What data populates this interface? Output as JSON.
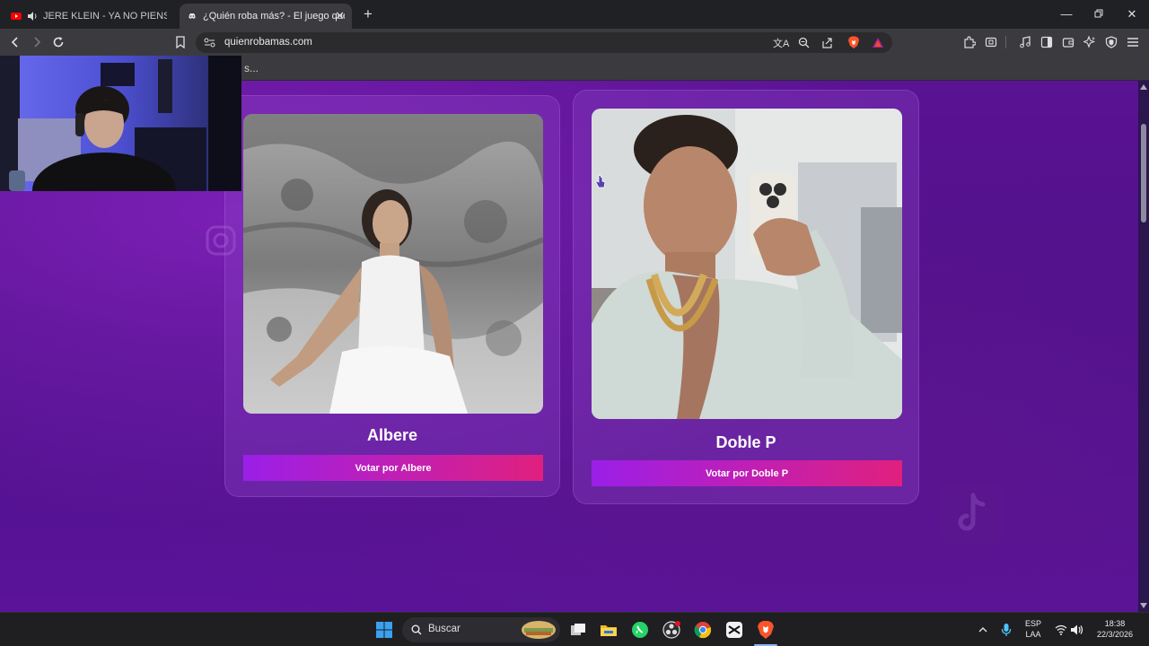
{
  "browser": {
    "tabs": [
      {
        "title": "JERE KLEIN - YA NO PIENSO EN T",
        "active": false,
        "audio": true
      },
      {
        "title": "¿Quién roba más? - El juego que",
        "active": true
      }
    ],
    "url": "quienrobamas.com",
    "bookmarks_overflow": "s..."
  },
  "page": {
    "candidates": [
      {
        "name": "Albere",
        "vote_label": "Votar por Albere"
      },
      {
        "name": "Doble P",
        "vote_label": "Votar por Doble P"
      }
    ]
  },
  "taskbar": {
    "search_placeholder": "Buscar",
    "language": "ESP",
    "layout": "LAA",
    "time": "18:38",
    "date": "22/3/2026"
  },
  "colors": {
    "page_bg": "#56138f",
    "vote_gradient_start": "#9b1fe8",
    "vote_gradient_end": "#e0207e",
    "brave_orange": "#fb542b"
  },
  "icons": [
    "youtube-icon",
    "speaker-icon",
    "discord-icon",
    "close-icon",
    "plus-icon",
    "minimize-icon",
    "restore-icon",
    "back-icon",
    "forward-icon",
    "reload-icon",
    "bookmark-icon",
    "site-info-icon",
    "translate-icon",
    "zoom-icon",
    "share-icon",
    "brave-shields-icon",
    "brave-rewards-icon",
    "extensions-icon",
    "screenshot-icon",
    "music-icon",
    "sidebar-icon",
    "wallet-icon",
    "leo-icon",
    "vpn-icon",
    "menu-icon",
    "windows-start-icon",
    "task-view-icon",
    "file-explorer-icon",
    "whatsapp-icon",
    "obs-icon",
    "chrome-icon",
    "capcut-icon",
    "brave-icon",
    "tray-chevron-icon",
    "microphone-icon",
    "wifi-icon",
    "volume-icon"
  ]
}
